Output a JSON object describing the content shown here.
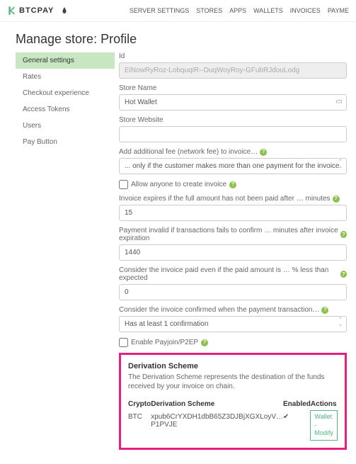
{
  "brand": {
    "text": "BTCPAY"
  },
  "nav": {
    "items": [
      "SERVER SETTINGS",
      "STORES",
      "APPS",
      "WALLETS",
      "INVOICES",
      "PAYME"
    ]
  },
  "page_title": "Manage store: Profile",
  "sidebar": {
    "items": [
      {
        "label": "General settings",
        "active": true
      },
      {
        "label": "Rates"
      },
      {
        "label": "Checkout experience"
      },
      {
        "label": "Access Tokens"
      },
      {
        "label": "Users"
      },
      {
        "label": "Pay Button"
      }
    ]
  },
  "form": {
    "id_label": "Id",
    "id_value": "EiNowRyRoz-LobquqiR--DuqWoyRoy-GFubRJdouLodg",
    "store_name_label": "Store Name",
    "store_name_value": "Hot Wallet",
    "store_website_label": "Store Website",
    "store_website_value": "",
    "network_fee_label": "Add additional fee (network fee) to invoice…",
    "network_fee_value": "... only if the customer makes more than one payment for the invoice",
    "allow_anyone_label": "Allow anyone to create invoice",
    "expires_label": "Invoice expires if the full amount has not been paid after … minutes",
    "expires_value": "15",
    "invalid_label": "Payment invalid if transactions fails to confirm … minutes after invoice expiration",
    "invalid_value": "1440",
    "paid_even_label": "Consider the invoice paid even if the paid amount is … % less than expected",
    "paid_even_value": "0",
    "confirmed_label": "Consider the invoice confirmed when the payment transaction…",
    "confirmed_value": "Has at least 1 confirmation",
    "payjoin_label": "Enable Payjoin/P2EP"
  },
  "derivation": {
    "title": "Derivation Scheme",
    "desc": "The Derivation Scheme represents the destination of the funds received by your invoice on chain.",
    "headers": {
      "crypto": "Crypto",
      "scheme": "Derivation Scheme",
      "enabled": "Enabled",
      "actions": "Actions"
    },
    "row": {
      "crypto": "BTC",
      "scheme": "xpub6CrYXDH1dbB65Z3DJBjXGXLoyV…P1PVJE",
      "enabled": "✔",
      "action1": "Wallet -",
      "action2": "Modify"
    }
  }
}
